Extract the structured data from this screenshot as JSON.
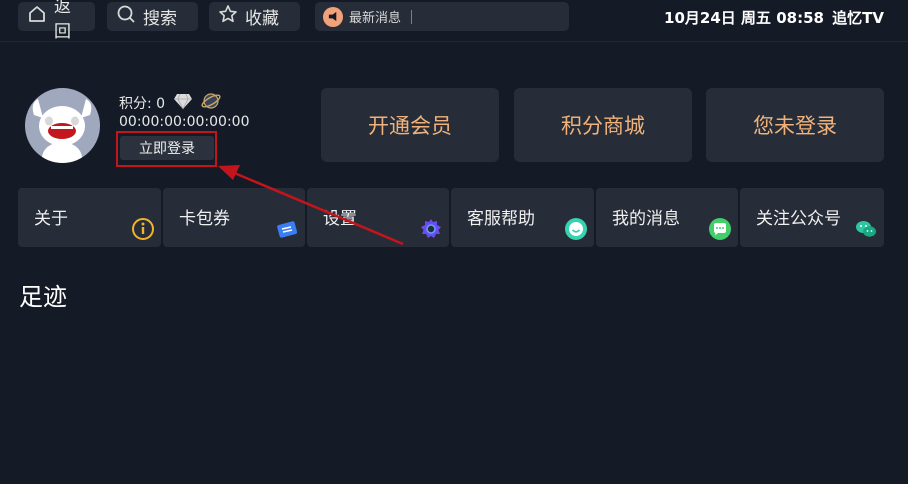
{
  "topbar": {
    "back_label": "返回",
    "search_label": "搜索",
    "favorites_label": "收藏",
    "news_label": "最新消息",
    "datetime": "10月24日 周五 08:58",
    "brand": "追忆TV"
  },
  "profile": {
    "score_text": "积分: 0",
    "timestamp": "00:00:00:00:00:00",
    "login_label": "立即登录"
  },
  "actions": {
    "vip_label": "开通会员",
    "shop_label": "积分商城",
    "login_status_label": "您未登录"
  },
  "menu": {
    "items": [
      {
        "label": "关于",
        "icon": "info-icon"
      },
      {
        "label": "卡包券",
        "icon": "ticket-icon"
      },
      {
        "label": "设置",
        "icon": "gear-icon"
      },
      {
        "label": "客服帮助",
        "icon": "smile-icon"
      },
      {
        "label": "我的消息",
        "icon": "chat-bubble-icon"
      },
      {
        "label": "关注公众号",
        "icon": "wechat-icon"
      }
    ]
  },
  "sections": {
    "footprint_title": "足迹"
  },
  "colors": {
    "background": "#141b27",
    "card": "#262d38",
    "accent_orange": "#f0b27a",
    "annotation_red": "#c4141c"
  }
}
